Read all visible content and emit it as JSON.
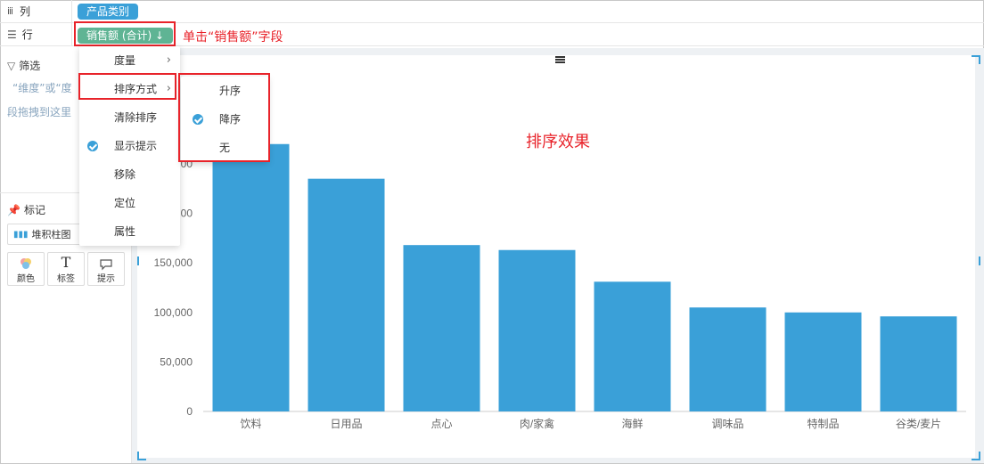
{
  "shelves": {
    "columns_label": "列",
    "rows_label": "行",
    "columns_pill": "产品类别",
    "rows_pill": "销售额 (合计) ↓"
  },
  "annotation_click": "单击“销售额”字段",
  "annotation_effect": "排序效果",
  "filter": {
    "title": "筛选",
    "hint1_a": "“维度”或“度",
    "hint2": "段拖拽到这里"
  },
  "marks": {
    "title": "标记",
    "type": "堆积柱图",
    "color": "颜色",
    "label": "标签",
    "tooltip": "提示"
  },
  "menu": {
    "items": [
      {
        "label": "度量",
        "submenu": true,
        "checked": false
      },
      {
        "label": "排序方式",
        "submenu": true,
        "checked": false
      },
      {
        "label": "清除排序",
        "submenu": false,
        "checked": false
      },
      {
        "label": "显示提示",
        "submenu": false,
        "checked": true
      },
      {
        "label": "移除",
        "submenu": false,
        "checked": false
      },
      {
        "label": "定位",
        "submenu": false,
        "checked": false
      },
      {
        "label": "属性",
        "submenu": false,
        "checked": false
      }
    ]
  },
  "submenu": {
    "items": [
      {
        "label": "升序",
        "checked": false
      },
      {
        "label": "降序",
        "checked": true
      },
      {
        "label": "无",
        "checked": false
      }
    ]
  },
  "colors": {
    "bar": "#3aa0d8",
    "accent": "#3aa0d8",
    "annotation": "#e8232a",
    "pill_green": "#5fb494"
  },
  "chart_data": {
    "type": "bar",
    "categories": [
      "饮料",
      "日用品",
      "点心",
      "肉/家禽",
      "海鲜",
      "调味品",
      "特制品",
      "谷类/麦片"
    ],
    "values": [
      270000,
      235000,
      168000,
      163000,
      131000,
      105000,
      100000,
      96000
    ],
    "yticks": [
      "0",
      "50,000",
      "100,000",
      "150,000",
      "00",
      "00"
    ],
    "ylim": [
      0,
      270000
    ]
  }
}
